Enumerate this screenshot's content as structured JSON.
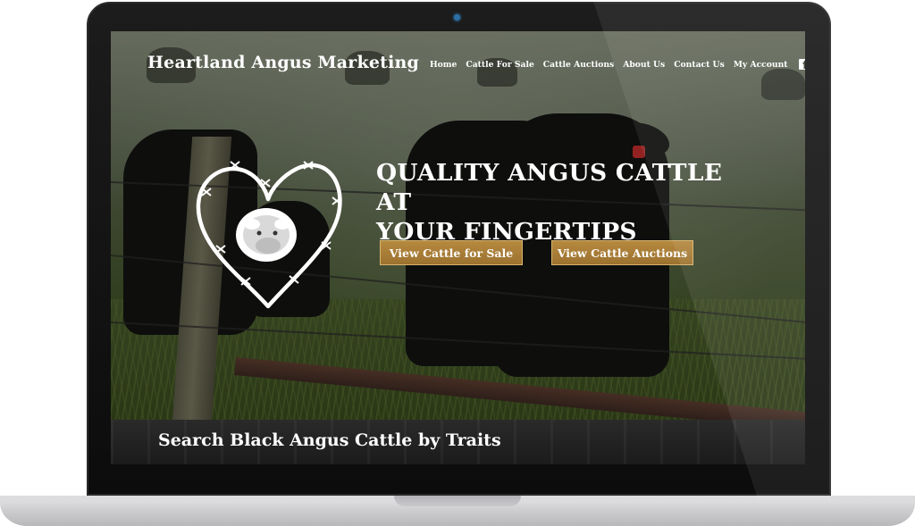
{
  "site": {
    "brand": "Heartland Angus Marketing"
  },
  "nav": {
    "items": [
      "Home",
      "Cattle For Sale",
      "Cattle Auctions",
      "About Us",
      "Contact Us",
      "My Account"
    ],
    "facebook_icon": "facebook-icon"
  },
  "hero": {
    "title_line1": "QUALITY ANGUS CATTLE AT",
    "title_line2": "YOUR FINGERTIPS",
    "button_sale": "View Cattle for Sale",
    "button_auctions": "View Cattle Auctions",
    "logo_icon": "barbed-wire-heart-cow-logo"
  },
  "search": {
    "title": "Search Black Angus Cattle by Traits"
  },
  "colors": {
    "button": "#a87b35",
    "button_border": "#d7b46e",
    "text": "#ffffff",
    "band": "#222222"
  }
}
